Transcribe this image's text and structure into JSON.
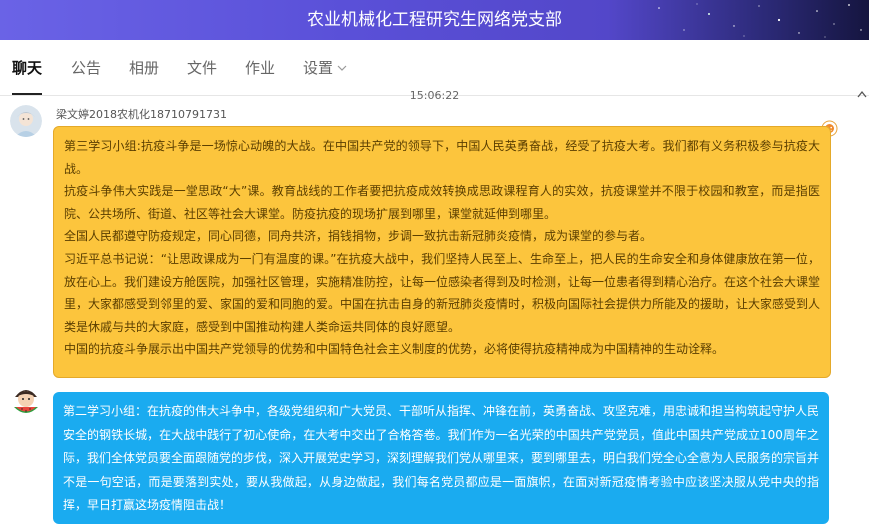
{
  "window": {
    "title": "农业机械化工程研究生网络党支部"
  },
  "tabs": [
    {
      "label": "聊天",
      "active": true
    },
    {
      "label": "公告"
    },
    {
      "label": "相册"
    },
    {
      "label": "文件"
    },
    {
      "label": "作业"
    },
    {
      "label": "设置",
      "has_dropdown": true
    }
  ],
  "chat": {
    "timestamp": "15:06:22",
    "messages": [
      {
        "sender": "梁文婷2018农机化18710791731",
        "avatar_icon": "cartoon-avatar",
        "bubble_color": "#fcc53d",
        "paragraphs": [
          "第三学习小组:抗疫斗争是一场惊心动魄的大战。在中国共产党的领导下，中国人民英勇奋战，经受了抗疫大考。我们都有义务积极参与抗疫大战。",
          "抗疫斗争伟大实践是一堂思政“大”课。教育战线的工作者要把抗疫成效转换成思政课程育人的实效，抗疫课堂并不限于校园和教室，而是指医院、公共场所、街道、社区等社会大课堂。防疫抗疫的现场扩展到哪里，课堂就延伸到哪里。",
          "全国人民都遵守防疫规定，同心同德，同舟共济，捐钱捐物，步调一致抗击新冠肺炎疫情，成为课堂的参与者。",
          "习近平总书记说：“让思政课成为一门有温度的课。”在抗疫大战中，我们坚持人民至上、生命至上，把人民的生命安全和身体健康放在第一位，放在心上。我们建设方舱医院，加强社区管理，实施精准防控，让每一位感染者得到及时检测，让每一位患者得到精心治疗。在这个社会大课堂里，大家都感受到邻里的爱、家国的爱和同胞的爱。中国在抗击自身的新冠肺炎疫情时，积极向国际社会提供力所能及的援助，让大家感受到人类是休戚与共的大家庭，感受到中国推动构建人类命运共同体的良好愿望。",
          "中国的抗疫斗争展示出中国共产党领导的优势和中国特色社会主义制度的优势，必将使得抗疫精神成为中国精神的生动诠释。"
        ]
      },
      {
        "sender": "",
        "avatar_icon": "watermelon-boy-avatar",
        "bubble_color": "#1aabf0",
        "paragraphs": [
          "第二学习小组：在抗疫的伟大斗争中，各级党组织和广大党员、干部听从指挥、冲锋在前，英勇奋战、攻坚克难，用忠诚和担当构筑起守护人民安全的钢铁长城，在大战中践行了初心使命，在大考中交出了合格答卷。我们作为一名光荣的中国共产党党员，值此中国共产党成立100周年之际，我们全体党员要全面跟随党的步伐，深入开展党史学习，深刻理解我们党从哪里来，要到哪里去，明白我们党全心全意为人民服务的宗旨并不是一句空话，而是要落到实处，要从我做起，从身边做起，我们每名党员都应是一面旗帜，在面对新冠疫情考验中应该坚决服从党中央的指挥，早日打赢这场疫情阻击战！"
        ]
      }
    ]
  }
}
